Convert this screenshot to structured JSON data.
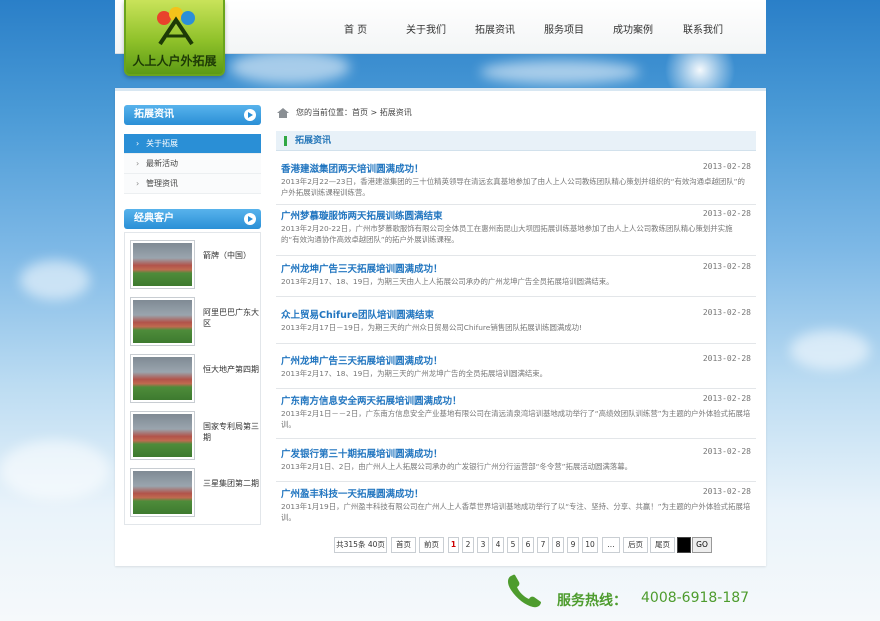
{
  "brand": {
    "logo_text": "人上人户外拓展"
  },
  "nav": {
    "items": [
      "首 页",
      "关于我们",
      "拓展资讯",
      "服务项目",
      "成功案例",
      "联系我们"
    ]
  },
  "sidebar": {
    "news_title": "拓展资讯",
    "menu": [
      {
        "label": "关于拓展",
        "active": true
      },
      {
        "label": "最新活动",
        "active": false
      },
      {
        "label": "管理资讯",
        "active": false
      }
    ],
    "clients_title": "经典客户",
    "clients": [
      {
        "name": "箭牌（中国）"
      },
      {
        "name": "阿里巴巴广东大区"
      },
      {
        "name": "恒大地产第四期"
      },
      {
        "name": "国家专利局第三期"
      },
      {
        "name": "三星集团第二期"
      }
    ]
  },
  "breadcrumb": {
    "text": "您的当前位置：首页 > 拓展资讯"
  },
  "section": {
    "title": "拓展资讯"
  },
  "news": [
    {
      "title": "香港建滋集团两天培训圆满成功！",
      "date": "2013-02-28",
      "summary": "2013年2月22—23日，香港建滋集团的三十位精英领导在清远玄真基地参加了由人上人公司教练团队精心策划并组织的“有效沟通卓越团队”的户外拓展训练课程训练营。"
    },
    {
      "title": "广州梦慕璇服饰两天拓展训练圆满结束",
      "date": "2013-02-28",
      "summary": "2013年2月20-22日，广州市梦慕歌服饰有限公司全体员工在惠州南昆山大坝园拓展训练基地参加了由人上人公司教练团队精心策划并实施的“有效沟通协作高效卓越团队”的拓户外展训练课程。"
    },
    {
      "title": "广州龙坤广告三天拓展培训圆满成功！",
      "date": "2013-02-28",
      "summary": "2013年2月17、18、19日，为期三天由人上人拓展公司承办的广州龙坤广告全员拓展培训圆满结束。"
    },
    {
      "title": "众上贸易Chifure团队培训圆满结束",
      "date": "2013-02-28",
      "summary": "2013年2月17日－19日，为期三天的广州众日贸易公司Chifure销售团队拓展训练圆满成功!"
    },
    {
      "title": "广州龙坤广告三天拓展培训圆满成功！",
      "date": "2013-02-28",
      "summary": "2013年2月17、18、19日，为期三天的广州龙坤广告的全员拓展培训圆满结束。"
    },
    {
      "title": "广东南方信息安全两天拓展培训圆满成功！",
      "date": "2013-02-28",
      "summary": "2013年2月1日－－2日，广东南方信息安全产业基地有限公司在清远清泉湾培训基地成功举行了“高绩效团队训练营”为主题的户外体验式拓展培训。"
    },
    {
      "title": "广发银行第三十期拓展培训圆满成功！",
      "date": "2013-02-28",
      "summary": "2013年2月1日、2日，由广州人上人拓展公司承办的广发银行广州分行运营部“冬令营”拓展活动圆满落幕。"
    },
    {
      "title": "广州盈丰科技一天拓展圆满成功！",
      "date": "2013-02-28",
      "summary": "2013年1月19日，广州盈丰科技有限公司在广州人上人香草世界培训基地成功举行了以“专注、坚持、分享、共赢！”为主题的户外体验式拓展培训。"
    }
  ],
  "pager": {
    "total": "共315条 40页",
    "first": "首页",
    "prev": "前页",
    "pages": [
      "1",
      "2",
      "3",
      "4",
      "5",
      "6",
      "7",
      "8",
      "9",
      "10",
      "..."
    ],
    "current": "1",
    "next": "后页",
    "last": "尾页",
    "go": "GO"
  },
  "hotline": {
    "label": "服务热线：",
    "number": "4008-6918-187"
  },
  "colors": {
    "accent_blue": "#2a8fd6",
    "title_blue": "#2276c0",
    "hotline_green": "#4e9c2e",
    "logo_green": "#8fc12a"
  }
}
